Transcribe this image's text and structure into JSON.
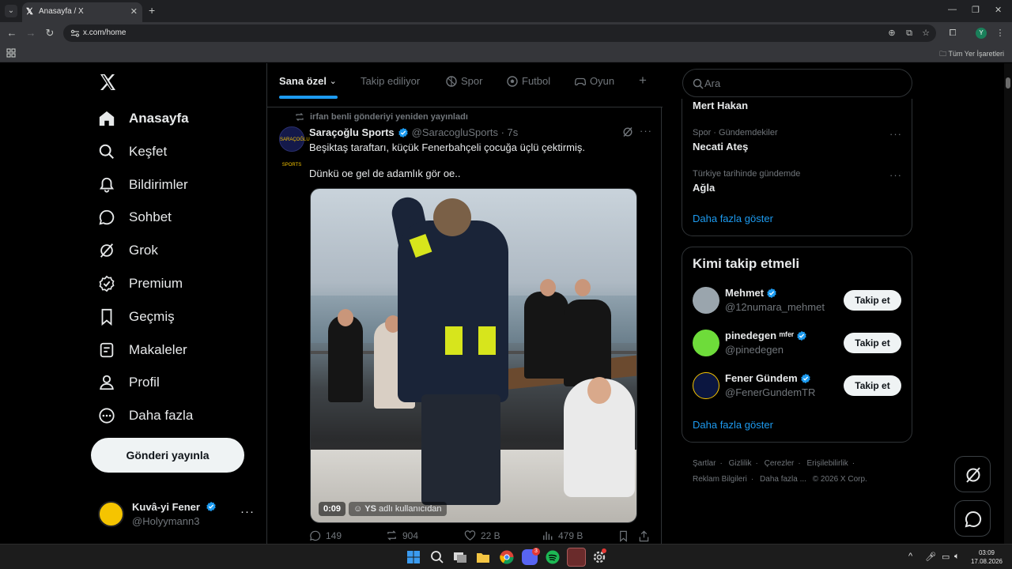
{
  "browser": {
    "tab_title": "Anasayfa / X",
    "url": "x.com/home",
    "bookmarks_folder": "Tüm Yer İşaretleri",
    "profile_initial": "Y"
  },
  "nav": {
    "items": [
      {
        "label": "Anasayfa",
        "icon": "home-icon"
      },
      {
        "label": "Keşfet",
        "icon": "search-icon"
      },
      {
        "label": "Bildirimler",
        "icon": "bell-icon"
      },
      {
        "label": "Sohbet",
        "icon": "chat-icon"
      },
      {
        "label": "Grok",
        "icon": "grok-icon"
      },
      {
        "label": "Premium",
        "icon": "verified-badge-icon"
      },
      {
        "label": "Geçmiş",
        "icon": "bookmark-icon"
      },
      {
        "label": "Makaleler",
        "icon": "article-icon"
      },
      {
        "label": "Profil",
        "icon": "person-icon"
      },
      {
        "label": "Daha fazla",
        "icon": "more-circle-icon"
      }
    ],
    "post_button": "Gönderi yayınla",
    "account": {
      "name": "Kuvâ-yi Fener",
      "handle": "@Holyymann3"
    }
  },
  "feed": {
    "tabs": [
      {
        "label": "Sana özel",
        "active": true
      },
      {
        "label": "Takip ediliyor"
      },
      {
        "label": "Spor"
      },
      {
        "label": "Futbol"
      },
      {
        "label": "Oyun"
      }
    ],
    "post": {
      "repost_by": "irfan benli gönderiyi yeniden yayınladı",
      "author_name": "Saraçoğlu Sports",
      "author_handle": "@SaracogluSports",
      "time": "· 7s",
      "avatar_text": "SARAÇOĞLU SPORTS",
      "text_line1": "Beşiktaş taraftarı, küçük Fenerbahçeli çocuğa üçlü çektirmiş.",
      "text_line2": "Dünkü oe gel de adamlık gör oe..",
      "video_time": "0:09",
      "video_via_name": "YS",
      "video_via_suffix": "adlı kullanıcıdan",
      "replies": "149",
      "reposts": "904",
      "likes": "22 B",
      "views": "479 B"
    }
  },
  "right": {
    "search_placeholder": "Ara",
    "trends": [
      {
        "context": "",
        "name": "Mert Hakan"
      },
      {
        "context": "Spor · Gündemdekiler",
        "name": "Necati Ateş"
      },
      {
        "context": "Türkiye tarihinde gündemde",
        "name": "Ağla"
      }
    ],
    "trends_show_more": "Daha fazla göster",
    "who_to_follow": {
      "title": "Kimi takip etmeli",
      "accounts": [
        {
          "name": "Mehmet",
          "handle": "@12numara_mehmet",
          "button": "Takip et"
        },
        {
          "name": "pinedegen ᵐᶠᵉʳ",
          "handle": "@pinedegen",
          "button": "Takip et"
        },
        {
          "name": "Fener Gündem",
          "handle": "@FenerGundemTR",
          "button": "Takip et"
        }
      ],
      "show_more": "Daha fazla göster"
    },
    "footer": [
      "Şartlar",
      "Gizlilik",
      "Çerezler",
      "Erişilebilirlik",
      "Reklam Bilgileri",
      "Daha fazla ...",
      "© 2026 X Corp."
    ]
  },
  "taskbar": {
    "time": "03:09",
    "date": "17.08.2026",
    "discord_badge": "3"
  },
  "colors": {
    "accent": "#1d9bf0",
    "background": "#000000",
    "text": "#e7e9ea",
    "muted": "#71767b",
    "border": "#2f3336"
  }
}
